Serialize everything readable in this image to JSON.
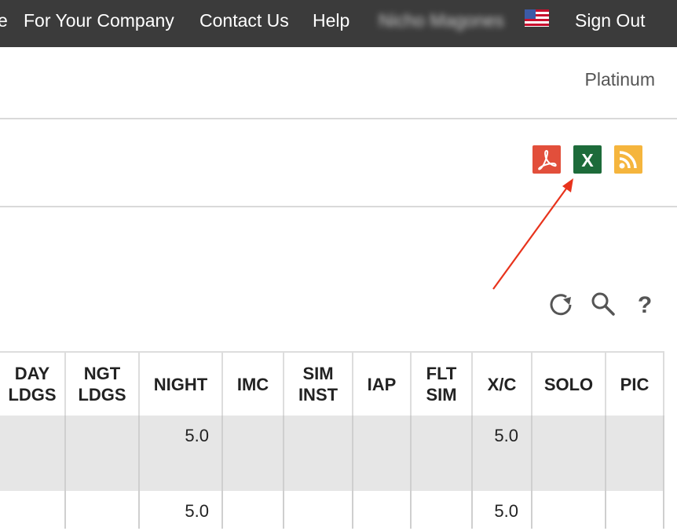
{
  "nav": {
    "partial_item": "e",
    "company": "For Your Company",
    "contact": "Contact Us",
    "help": "Help",
    "user_name": "Nicho Magones",
    "sign_out": "Sign Out"
  },
  "header": {
    "tier": "Platinum"
  },
  "exports": {
    "pdf_icon": "pdf-icon",
    "excel_icon": "excel-icon",
    "excel_letter": "X",
    "rss_icon": "rss-icon"
  },
  "tools": [
    "refresh-icon",
    "search-icon",
    "help-icon"
  ],
  "tools_help_glyph": "?",
  "table": {
    "headers": [
      [
        "DAY",
        "LDGS"
      ],
      [
        "NGT",
        "LDGS"
      ],
      [
        "NIGHT"
      ],
      [
        "IMC"
      ],
      [
        "SIM",
        "INST"
      ],
      [
        "IAP"
      ],
      [
        "FLT",
        "SIM"
      ],
      [
        "X/C"
      ],
      [
        "SOLO"
      ],
      [
        "PIC"
      ]
    ],
    "rows": [
      [
        "",
        "",
        "5.0",
        "",
        "",
        "",
        "",
        "5.0",
        "",
        ""
      ],
      [
        "",
        "",
        "",
        "",
        "",
        "",
        "",
        "",
        "",
        ""
      ],
      [
        "",
        "",
        "5.0",
        "",
        "",
        "",
        "",
        "5.0",
        "",
        ""
      ]
    ]
  },
  "colors": {
    "nav_bg": "#3b3b3b",
    "pdf": "#e24f3b",
    "excel": "#1d6b3a",
    "rss": "#f5b53d",
    "annotation_arrow": "#e8331c",
    "row_shade": "#e6e6e6"
  }
}
